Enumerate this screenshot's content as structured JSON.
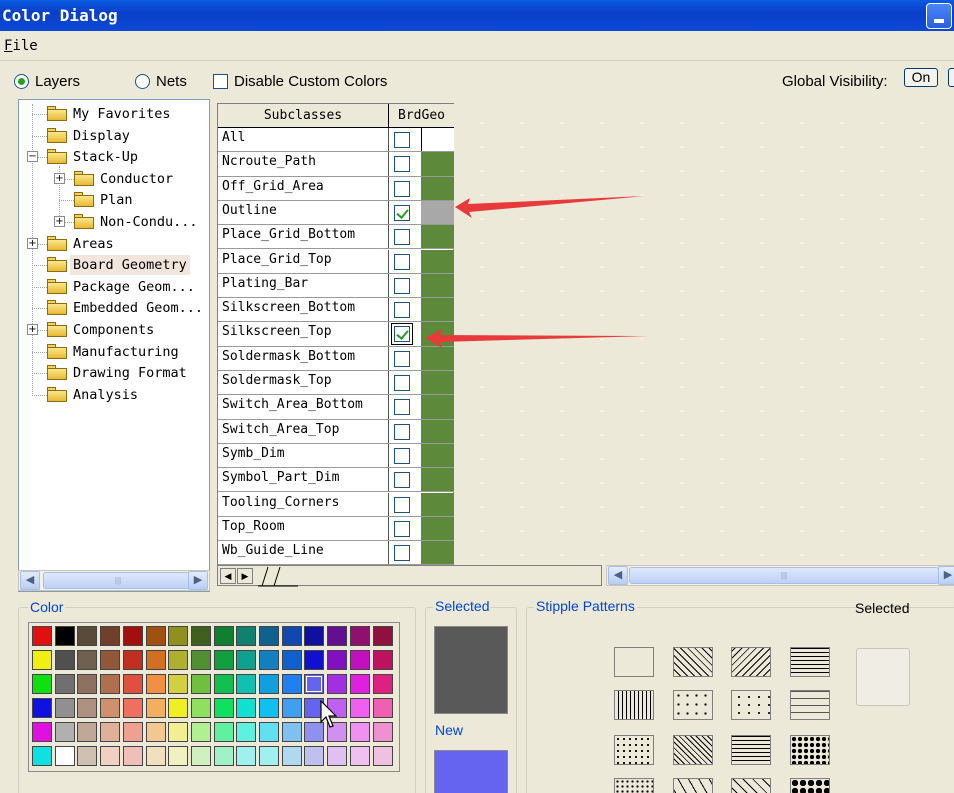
{
  "window": {
    "title": "Color Dialog"
  },
  "menu": {
    "file_label": "File"
  },
  "toolbar": {
    "layers_label": "Layers",
    "nets_label": "Nets",
    "disable_custom_label": "Disable Custom Colors",
    "global_visibility_label": "Global Visibility:",
    "on_label": "On"
  },
  "tree": {
    "items": [
      {
        "label": "My Favorites"
      },
      {
        "label": "Display"
      },
      {
        "label": "Stack-Up"
      },
      {
        "label": "Conductor"
      },
      {
        "label": "Plan"
      },
      {
        "label": "Non-Condu..."
      },
      {
        "label": "Areas"
      },
      {
        "label": "Board Geometry"
      },
      {
        "label": "Package Geom..."
      },
      {
        "label": "Embedded Geom..."
      },
      {
        "label": "Components"
      },
      {
        "label": "Manufacturing"
      },
      {
        "label": "Drawing Format"
      },
      {
        "label": "Analysis"
      }
    ]
  },
  "grid": {
    "col_subclasses": "Subclasses",
    "col_brdgeo": "BrdGeo",
    "rows": [
      {
        "name": "All",
        "checked": false
      },
      {
        "name": "Ncroute_Path",
        "checked": false
      },
      {
        "name": "Off_Grid_Area",
        "checked": false
      },
      {
        "name": "Outline",
        "checked": true
      },
      {
        "name": "Place_Grid_Bottom",
        "checked": false
      },
      {
        "name": "Place_Grid_Top",
        "checked": false
      },
      {
        "name": "Plating_Bar",
        "checked": false
      },
      {
        "name": "Silkscreen_Bottom",
        "checked": false
      },
      {
        "name": "Silkscreen_Top",
        "checked": true
      },
      {
        "name": "Soldermask_Bottom",
        "checked": false
      },
      {
        "name": "Soldermask_Top",
        "checked": false
      },
      {
        "name": "Switch_Area_Bottom",
        "checked": false
      },
      {
        "name": "Switch_Area_Top",
        "checked": false
      },
      {
        "name": "Symb_Dim",
        "checked": false
      },
      {
        "name": "Symbol_Part_Dim",
        "checked": false
      },
      {
        "name": "Tooling_Corners",
        "checked": false
      },
      {
        "name": "Top_Room",
        "checked": false
      },
      {
        "name": "Wb_Guide_Line",
        "checked": false
      }
    ]
  },
  "color_panel": {
    "color_label": "Color",
    "selected_label": "Selected",
    "new_label": "New",
    "stipple_label": "Stipple Patterns",
    "stipple_selected_label": "Selected",
    "selected_color": "#595959",
    "new_color": "#6464f0",
    "palette": [
      [
        "#e01010",
        "#000000",
        "#5a4a3a",
        "#704028",
        "#a01010",
        "#a05010",
        "#909020",
        "#406020",
        "#108030",
        "#108070",
        "#106090",
        "#1048b0",
        "#1010a0",
        "#601090",
        "#901070",
        "#901040"
      ],
      [
        "#f0f010",
        "#505050",
        "#706050",
        "#905838",
        "#c03020",
        "#d07020",
        "#b0b030",
        "#509030",
        "#10a040",
        "#10a090",
        "#1080c0",
        "#1060d0",
        "#1010d0",
        "#8010c0",
        "#c010c0",
        "#c01060"
      ],
      [
        "#10e010",
        "#707070",
        "#907060",
        "#b07050",
        "#e05040",
        "#f09040",
        "#d0d040",
        "#70c040",
        "#10c050",
        "#10c0b0",
        "#10a0e0",
        "#2080f0",
        "#6464f0",
        "#a030e0",
        "#e020e0",
        "#e02080"
      ],
      [
        "#1010e0",
        "#909090",
        "#b09080",
        "#d09070",
        "#f07060",
        "#f0b060",
        "#f0f020",
        "#90e060",
        "#10e060",
        "#10e0d0",
        "#10c0f0",
        "#40a0f0",
        "#6464f0",
        "#c060f0",
        "#f060f0",
        "#f060b0"
      ],
      [
        "#e010e0",
        "#b0b0b0",
        "#c0a898",
        "#e0b098",
        "#f0a090",
        "#f0c890",
        "#f0f090",
        "#b0f090",
        "#60f0a0",
        "#60f0e0",
        "#60e0f0",
        "#80c0f0",
        "#9090f0",
        "#d090f0",
        "#f090f0",
        "#f090d0"
      ],
      [
        "#10e0e0",
        "#ffffff",
        "#d0c0b0",
        "#f0d0c0",
        "#f0c0b8",
        "#f0e0c0",
        "#f0f0c0",
        "#d0f0c0",
        "#a0f0c8",
        "#a0f0f0",
        "#a0f0f0",
        "#b0d8f0",
        "#c0c0f0",
        "#e0c0f0",
        "#f0c0f0",
        "#f0c0e0"
      ]
    ]
  }
}
